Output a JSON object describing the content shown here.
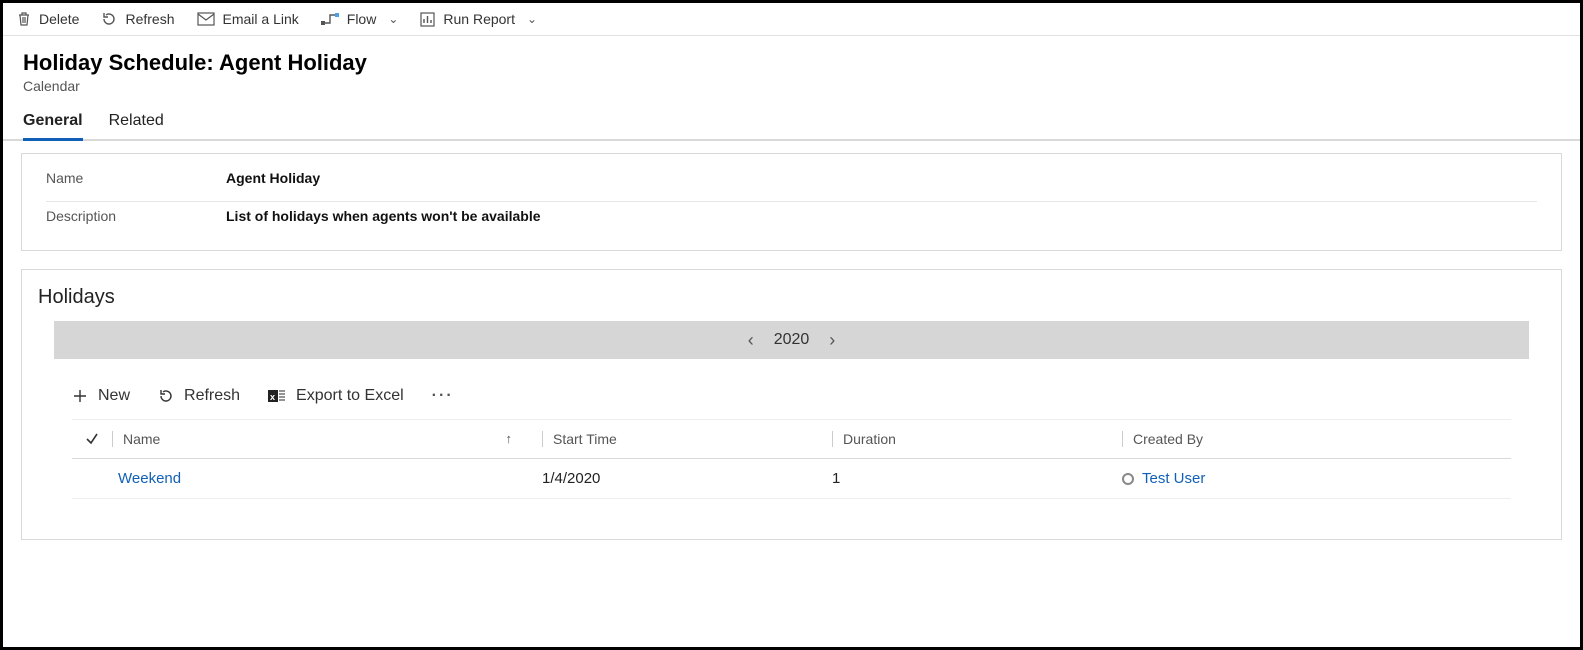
{
  "commandBar": {
    "delete": "Delete",
    "refresh": "Refresh",
    "emailLink": "Email a Link",
    "flow": "Flow",
    "runReport": "Run Report"
  },
  "header": {
    "title": "Holiday Schedule: Agent Holiday",
    "subtitle": "Calendar"
  },
  "tabs": {
    "general": "General",
    "related": "Related"
  },
  "form": {
    "nameLabel": "Name",
    "nameValue": "Agent Holiday",
    "descLabel": "Description",
    "descValue": "List of holidays when agents won't be available"
  },
  "holidays": {
    "sectionTitle": "Holidays",
    "year": "2020",
    "subCmd": {
      "new": "New",
      "refresh": "Refresh",
      "export": "Export to Excel"
    },
    "columns": {
      "name": "Name",
      "start": "Start Time",
      "duration": "Duration",
      "createdBy": "Created By"
    },
    "rows": [
      {
        "name": "Weekend",
        "start": "1/4/2020",
        "duration": "1",
        "createdBy": "Test User"
      }
    ]
  }
}
